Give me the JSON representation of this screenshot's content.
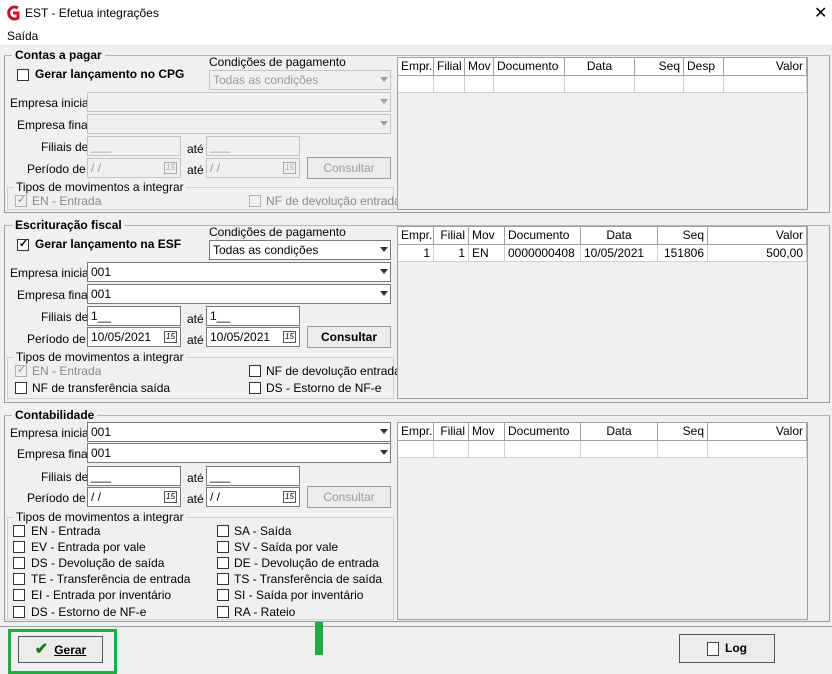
{
  "window": {
    "title": "EST - Efetua integrações",
    "close": "✕"
  },
  "menu": {
    "items": [
      "Saída"
    ]
  },
  "cpg": {
    "section": "Contas a pagar",
    "gerar_label": "Gerar lançamento no CPG",
    "gerar_checked": false,
    "cond_label": "Condições de pagamento",
    "cond_value": "Todas as condições",
    "empresa_inicial_label": "Empresa inicial",
    "empresa_inicial_value": "",
    "empresa_final_label": "Empresa final",
    "empresa_final_value": "",
    "filiais_label": "Filiais de",
    "filiais_de": "___",
    "ate1": "até",
    "filiais_ate": "___",
    "periodo_label": "Período de",
    "periodo_de": " / /",
    "ate2": "até",
    "periodo_ate": " / /",
    "consultar": "Consultar",
    "tipos_label": "Tipos de movimentos a integrar",
    "en_label": "EN - Entrada",
    "nfdev_label": "NF de devolução entrada",
    "grid_headers": [
      "Empr.",
      "Filial",
      "Mov",
      "Documento",
      "Data",
      "Seq",
      "Desp",
      "Valor"
    ]
  },
  "esf": {
    "section": "Escrituração fiscal",
    "gerar_label": "Gerar lançamento na ESF",
    "gerar_checked": true,
    "cond_label": "Condições de pagamento",
    "cond_value": "Todas as condições",
    "empresa_inicial_label": "Empresa inicial",
    "empresa_inicial_value": "001",
    "empresa_final_label": "Empresa final",
    "empresa_final_value": "001",
    "filiais_label": "Filiais de",
    "filiais_de": "1__",
    "ate1": "até",
    "filiais_ate": "1__",
    "periodo_label": "Período de",
    "periodo_de": "10/05/2021",
    "ate2": "até",
    "periodo_ate": "10/05/2021",
    "consultar": "Consultar",
    "tipos_label": "Tipos de movimentos a integrar",
    "en_label": "EN - Entrada",
    "nfdev_label": "NF de devolução entrada",
    "nftransf_label": "NF de transferência saída",
    "ds_label": "DS - Estorno de NF-e",
    "grid_headers": [
      "Empr.",
      "Filial",
      "Mov",
      "Documento",
      "Data",
      "Seq",
      "Valor"
    ],
    "rows": [
      {
        "empr": "1",
        "filial": "1",
        "mov": "EN",
        "documento": "0000000408",
        "data": "10/05/2021",
        "seq": "151806",
        "valor": "500,00"
      }
    ]
  },
  "ctb": {
    "section": "Contabilidade",
    "empresa_inicial_label": "Empresa inicial",
    "empresa_inicial_value": "001",
    "empresa_final_label": "Empresa final",
    "empresa_final_value": "001",
    "filiais_label": "Filiais de",
    "filiais_de": "___",
    "ate1": "até",
    "filiais_ate": "___",
    "periodo_label": "Período de",
    "periodo_de": " / /",
    "ate2": "até",
    "periodo_ate": " / /",
    "consultar": "Consultar",
    "tipos_label": "Tipos de movimentos a integrar",
    "left_types": [
      "EN - Entrada",
      "EV - Entrada por vale",
      "DS - Devolução de saída",
      "TE - Transferência de entrada",
      "EI - Entrada por inventário",
      "DS - Estorno de NF-e"
    ],
    "right_types": [
      "SA - Saída",
      "SV - Saída por vale",
      "DE - Devolução de entrada",
      "TS - Transferência de saída",
      "SI - Saída por inventário",
      "RA - Rateio"
    ],
    "grid_headers": [
      "Empr.",
      "Filial",
      "Mov",
      "Documento",
      "Data",
      "Seq",
      "Valor"
    ]
  },
  "footer": {
    "gerar": "Gerar",
    "log": "Log"
  },
  "calendar_icon_text": "15",
  "colors": {
    "highlight": "#22aa44",
    "check": "#1a7a1a",
    "logo": "#c8102e"
  }
}
